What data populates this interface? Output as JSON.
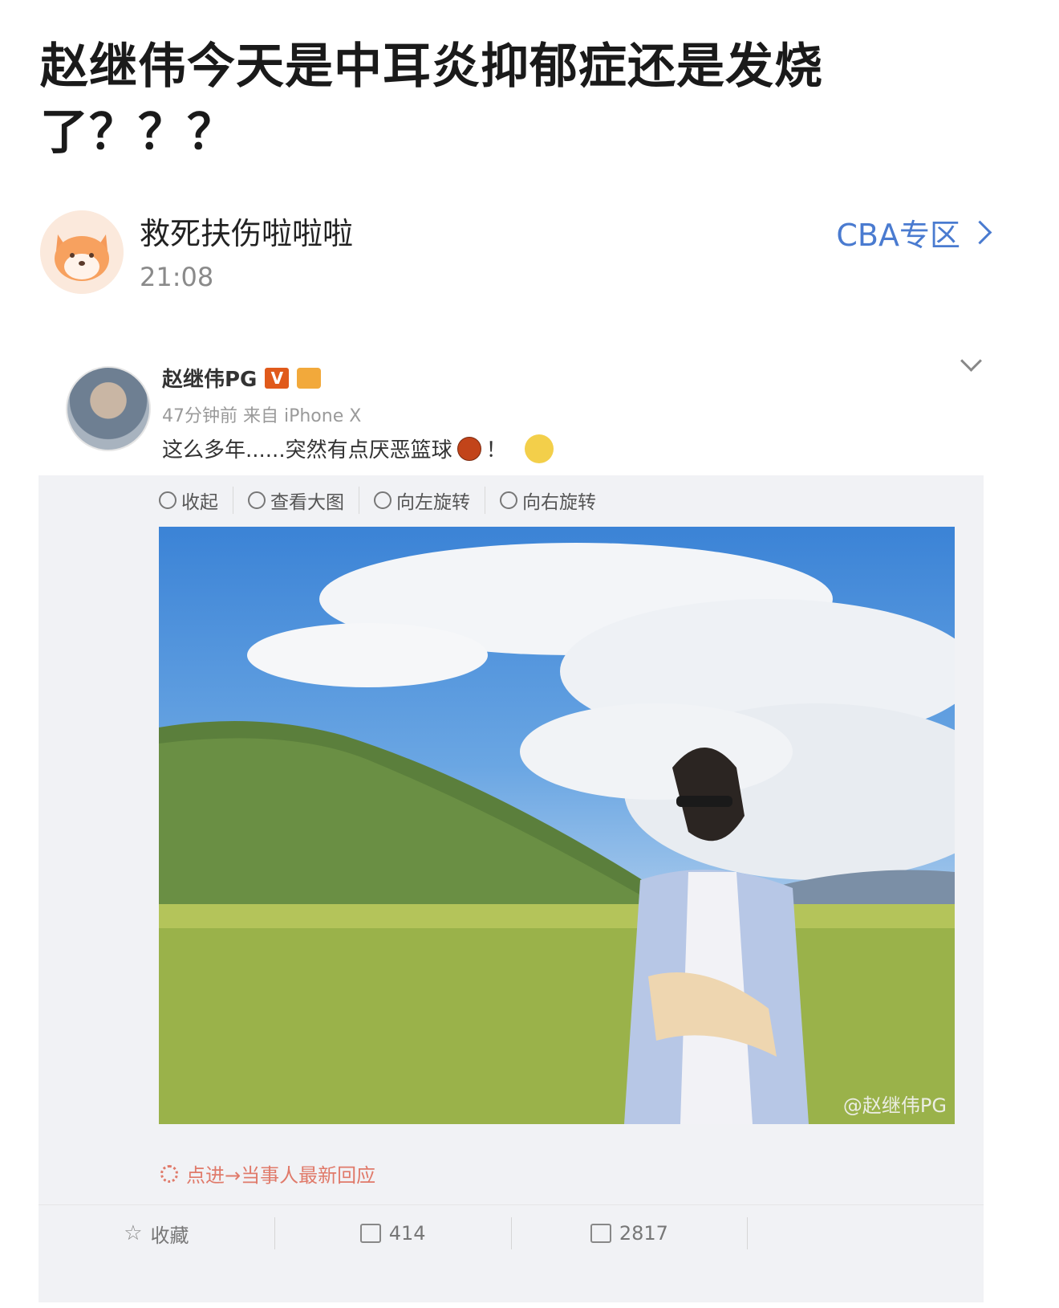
{
  "post": {
    "title": "赵继伟今天是中耳炎抑郁症还是发烧了？？？",
    "author": "救死扶伤啦啦啦",
    "time": "21:08",
    "topic": "CBA专区"
  },
  "screenshot": {
    "user": "赵继伟PG",
    "verified_badge": "V",
    "meta": "47分钟前 来自 iPhone X",
    "text": "这么多年......突然有点厌恶篮球",
    "text_end": "！",
    "toolbar": [
      "收起",
      "查看大图",
      "向左旋转",
      "向右旋转"
    ],
    "watermark": "@赵继伟PG",
    "promo": "点进→当事人最新回应",
    "actions": {
      "favorite": "收藏",
      "reposts": "414",
      "comments": "2817"
    }
  },
  "colors": {
    "link": "#4a7bd0",
    "promo": "#e07a6a",
    "badge": "#e05a1b"
  }
}
